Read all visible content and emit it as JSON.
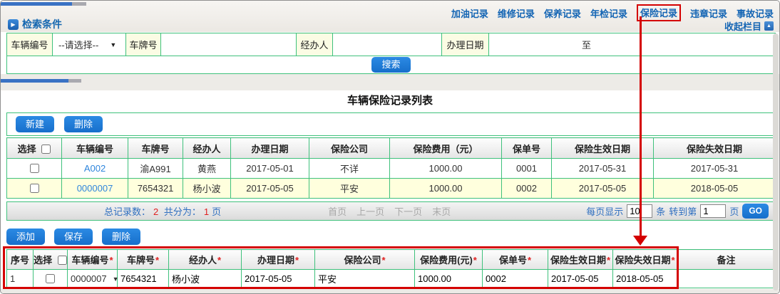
{
  "colors": {
    "accent_blue": "#1877d2",
    "nav_blue": "#1465b4",
    "link_blue": "#2f86dc",
    "grid_green": "#3fc17c",
    "highlight_red": "#d40000",
    "count_red": "#e02020",
    "row_alt_yellow": "#ffffdd",
    "label_yellow": "#fbfce4"
  },
  "icons": {
    "section_arrow": "▶",
    "collapse_arrow": "▲",
    "dropdown_arrow": "▼"
  },
  "nav": {
    "items": [
      {
        "label": "加油记录"
      },
      {
        "label": "维修记录"
      },
      {
        "label": "保养记录"
      },
      {
        "label": "年检记录"
      },
      {
        "label": "保险记录"
      },
      {
        "label": "违章记录"
      },
      {
        "label": "事故记录"
      }
    ],
    "highlighted_item": "保险记录",
    "collapse_label": "收起栏目"
  },
  "search": {
    "section_title": "检索条件",
    "vehicle_label": "车辆编号",
    "vehicle_value": "--请选择--",
    "plate_label": "车牌号",
    "plate_value": "",
    "handler_label": "经办人",
    "handler_value": "",
    "date_label": "办理日期",
    "date_from": "",
    "date_separator": "至",
    "date_to": "",
    "button": "搜索"
  },
  "list": {
    "title": "车辆保险记录列表",
    "new_button": "新建",
    "delete_button": "删除",
    "columns": [
      "选择",
      "车辆编号",
      "车牌号",
      "经办人",
      "办理日期",
      "保险公司",
      "保险费用（元）",
      "保单号",
      "保险生效日期",
      "保险失效日期"
    ],
    "rows": [
      {
        "vehicle_no": "A002",
        "plate": "渝A991",
        "handler": "黄燕",
        "date": "2017-05-01",
        "company": "不详",
        "fee": "1000.00",
        "policy_no": "0001",
        "effective_date": "2017-05-31",
        "expiry_date": "2017-05-31"
      },
      {
        "vehicle_no": "0000007",
        "plate": "7654321",
        "handler": "杨小波",
        "date": "2017-05-05",
        "company": "平安",
        "fee": "1000.00",
        "policy_no": "0002",
        "effective_date": "2017-05-05",
        "expiry_date": "2018-05-05"
      }
    ]
  },
  "pagination": {
    "total_label": "总记录数：",
    "total_value": "2",
    "pages_label": "共分为：",
    "pages_value": "1",
    "pages_suffix": "页",
    "first": "首页",
    "prev": "上一页",
    "next": "下一页",
    "last": "末页",
    "per_page_label": "每页显示",
    "per_page_value": "10",
    "per_page_suffix": "条",
    "goto_label": "转到第",
    "goto_value": "1",
    "goto_suffix": "页",
    "go_button": "GO"
  },
  "edit": {
    "add_button": "添加",
    "save_button": "保存",
    "delete_button": "删除",
    "required_mark": "*",
    "columns": [
      "序号",
      "选择",
      "车辆编号",
      "车牌号",
      "经办人",
      "办理日期",
      "保险公司",
      "保险费用(元)",
      "保单号",
      "保险生效日期",
      "保险失效日期",
      "备注"
    ],
    "row": {
      "index": "1",
      "vehicle_no": "0000007",
      "plate": "7654321",
      "handler": "杨小波",
      "date": "2017-05-05",
      "company": "平安",
      "fee": "1000.00",
      "policy_no": "0002",
      "effective_date": "2017-05-05",
      "expiry_date": "2018-05-05",
      "remark": ""
    }
  }
}
